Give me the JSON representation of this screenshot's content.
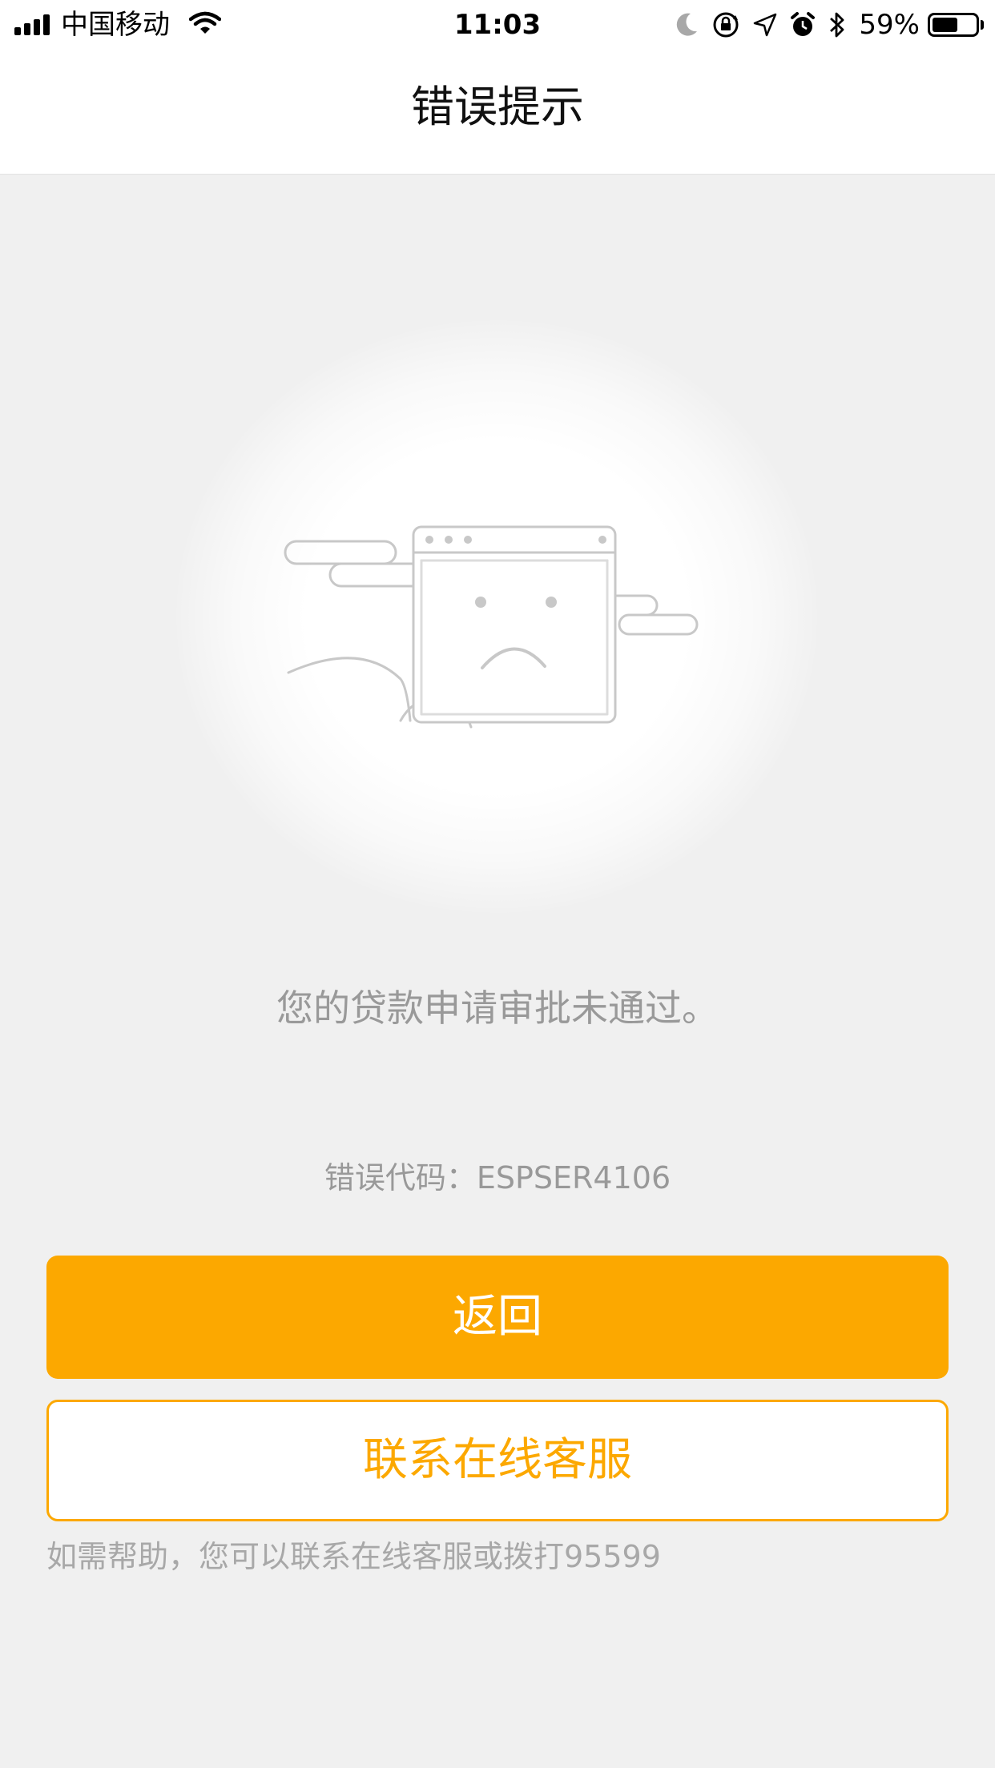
{
  "status_bar": {
    "carrier": "中国移动",
    "time": "11:03",
    "battery_percent": "59%",
    "battery_level": 0.59,
    "icons": [
      "signal-icon",
      "wifi-icon",
      "moon-icon",
      "rotation-lock-icon",
      "location-icon",
      "alarm-icon",
      "bluetooth-icon",
      "battery-icon"
    ]
  },
  "nav": {
    "title": "错误提示"
  },
  "illustration": {
    "icon": "sad-browser-window-illustration"
  },
  "content": {
    "message": "您的贷款申请审批未通过。",
    "error_code": "错误代码：ESPSER4106"
  },
  "actions": {
    "back_label": "返回",
    "contact_label": "联系在线客服"
  },
  "help": {
    "text": "如需帮助，您可以联系在线客服或拨打95599"
  },
  "colors": {
    "accent": "#fca800",
    "background": "#f0f0f0",
    "muted_text": "#999999"
  }
}
